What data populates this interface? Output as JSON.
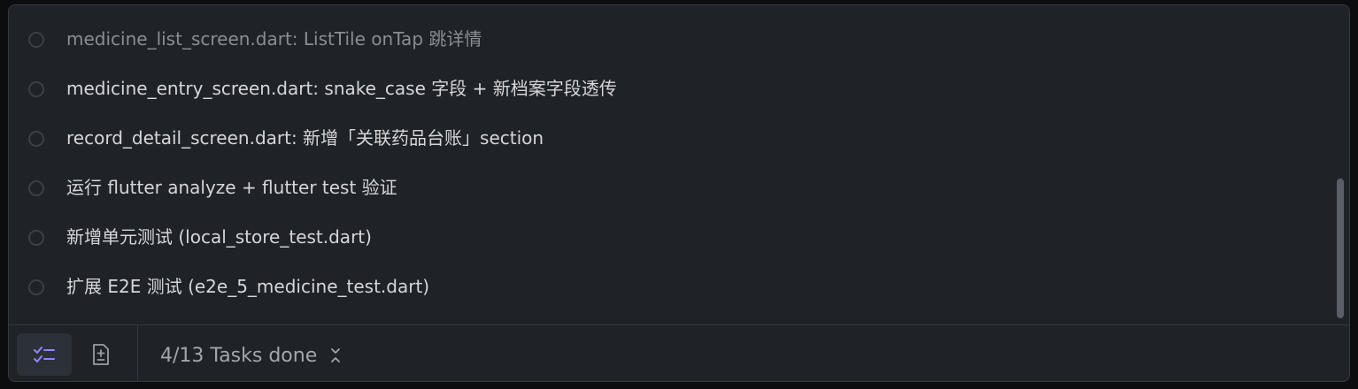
{
  "tasks": [
    {
      "label": "medicine_list_screen.dart: ListTile onTap 跳详情",
      "done": false
    },
    {
      "label": "medicine_entry_screen.dart: snake_case 字段 + 新档案字段透传",
      "done": false
    },
    {
      "label": "record_detail_screen.dart: 新增「关联药品台账」section",
      "done": false
    },
    {
      "label": "运行 flutter analyze + flutter test 验证",
      "done": false
    },
    {
      "label": "新增单元测试 (local_store_test.dart)",
      "done": false
    },
    {
      "label": "扩展 E2E 测试 (e2e_5_medicine_test.dart)",
      "done": false
    }
  ],
  "footer": {
    "tasks_summary": "4/13 Tasks done",
    "icons": {
      "tasks_tab": "checklist-icon",
      "diff_tab": "file-diff-icon",
      "toggle": "chevron-up-down-icon"
    }
  },
  "colors": {
    "panel_bg": "#1f2227",
    "accent": "#8f86ff",
    "text": "#d4d6da"
  }
}
